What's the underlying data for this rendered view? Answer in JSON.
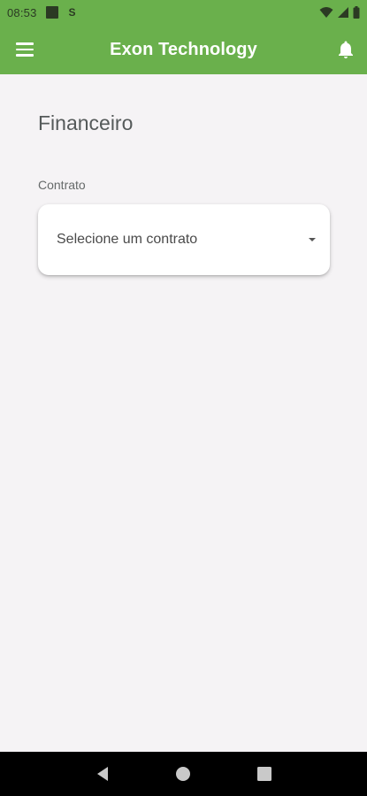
{
  "status_bar": {
    "time": "08:53",
    "icons": [
      "notification-square-icon",
      "s-app-icon",
      "wifi-icon",
      "signal-icon",
      "battery-icon"
    ]
  },
  "app_bar": {
    "title": "Exon Technology",
    "background": "#6ab04c",
    "menu_icon": "hamburger-menu-icon",
    "bell_icon": "notification-bell-icon"
  },
  "main": {
    "title": "Financeiro",
    "contract_label": "Contrato",
    "contract_select": {
      "selected_text": "Selecione um contrato"
    }
  },
  "nav_bar": {
    "buttons": [
      "back-icon",
      "home-icon",
      "recents-icon"
    ]
  }
}
